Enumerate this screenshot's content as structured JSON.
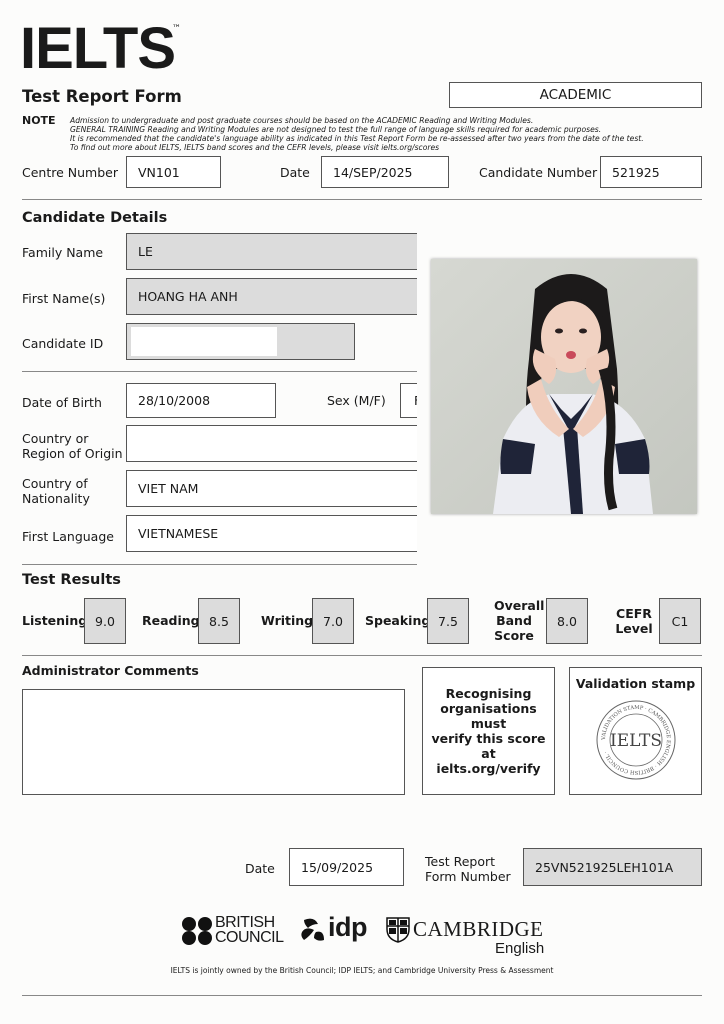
{
  "header": {
    "brand": "IELTS",
    "tm": "™",
    "title": "Test Report Form",
    "module": "ACADEMIC",
    "note_label": "NOTE",
    "note_lines": [
      "Admission to undergraduate and post graduate courses should be based on the ACADEMIC Reading and Writing Modules.",
      "GENERAL TRAINING Reading and Writing Modules are not designed to test the full range of language skills required for academic purposes.",
      "It is recommended that the candidate's language ability as indicated in this Test Report Form be re-assessed after two years from the date of the test.",
      "To find out more about IELTS, IELTS band scores and the CEFR levels, please visit ielts.org/scores"
    ]
  },
  "top_fields": {
    "centre_label": "Centre Number",
    "centre_value": "VN101",
    "date_label": "Date",
    "date_value": "14/SEP/2025",
    "candidate_number_label": "Candidate Number",
    "candidate_number_value": "521925"
  },
  "candidate": {
    "section_title": "Candidate Details",
    "family_name_label": "Family Name",
    "family_name": "LE",
    "first_name_label": "First Name(s)",
    "first_name": "HOANG HA ANH",
    "candidate_id_label": "Candidate ID",
    "candidate_id": "",
    "dob_label": "Date of Birth",
    "dob": "28/10/2008",
    "sex_label": "Sex (M/F)",
    "sex": "F",
    "origin_label_1": "Country or",
    "origin_label_2": "Region of Origin",
    "origin": "",
    "nationality_label_1": "Country of",
    "nationality_label_2": "Nationality",
    "nationality": "VIET NAM",
    "language_label": "First Language",
    "language": "VIETNAMESE"
  },
  "results": {
    "section_title": "Test Results",
    "listening_label": "Listening",
    "listening": "9.0",
    "reading_label": "Reading",
    "reading": "8.5",
    "writing_label": "Writing",
    "writing": "7.0",
    "speaking_label": "Speaking",
    "speaking": "7.5",
    "overall_label_1": "Overall",
    "overall_label_2": "Band",
    "overall_label_3": "Score",
    "overall": "8.0",
    "cefr_label_1": "CEFR",
    "cefr_label_2": "Level",
    "cefr": "C1"
  },
  "admin": {
    "comments_title": "Administrator Comments",
    "verify_line_1": "Recognising",
    "verify_line_2": "organisations must",
    "verify_line_3": "verify this score at",
    "verify_line_4": "ielts.org/verify",
    "stamp_title": "Validation stamp",
    "stamp_text": "IELTS",
    "stamp_ring": "VALIDATION STAMP · CAMBRIDGE ENGLISH · BRITISH COUNCIL ·"
  },
  "bottom": {
    "date_label": "Date",
    "date_value": "15/09/2025",
    "trf_label_1": "Test Report",
    "trf_label_2": "Form Number",
    "trf_value": "25VN521925LEH101A"
  },
  "footer": {
    "british_1": "BRITISH",
    "british_2": "COUNCIL",
    "idp": "idp",
    "cambridge_1": "CAMBRIDGE",
    "cambridge_2": "English",
    "ownership": "IELTS is jointly owned by the British Council; IDP IELTS; and Cambridge University Press & Assessment"
  },
  "colors": {
    "field_grey": "#dcdcdc",
    "text": "#1a1a1a",
    "border": "#555555"
  }
}
